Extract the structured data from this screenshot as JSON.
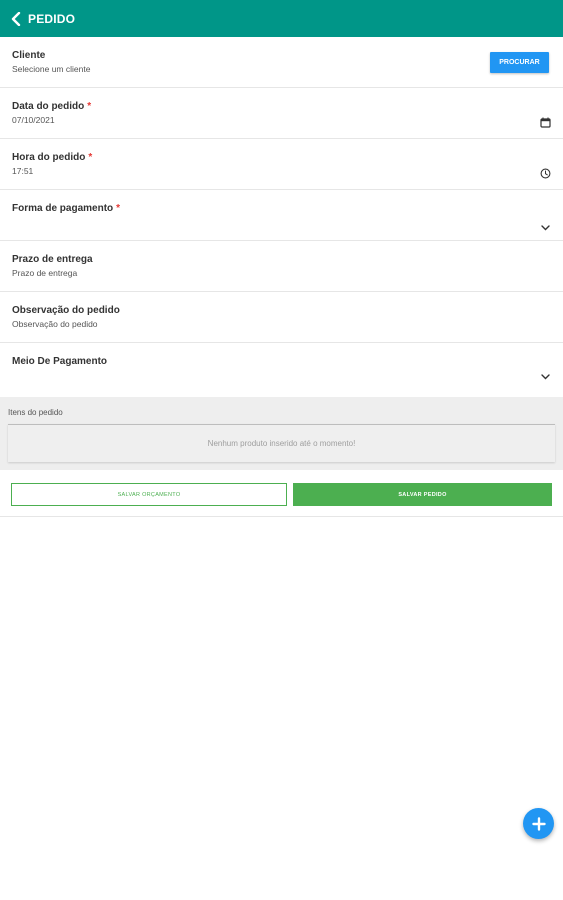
{
  "appbar": {
    "title": "PEDIDO",
    "back_icon": "chevron-left-icon"
  },
  "form": {
    "cliente": {
      "label": "Cliente",
      "value": "Selecione um cliente",
      "button_label": "PROCURAR"
    },
    "data_pedido": {
      "label": "Data do pedido",
      "required": "*",
      "value": "07/10/2021",
      "icon": "calendar-icon"
    },
    "hora_pedido": {
      "label": "Hora do pedido",
      "required": "*",
      "value": "17:51",
      "icon": "clock-icon"
    },
    "forma_pagamento": {
      "label": "Forma de pagamento",
      "required": "*",
      "value": "",
      "icon": "chevron-down-icon"
    },
    "prazo_entrega": {
      "label": "Prazo de entrega",
      "placeholder": "Prazo de entrega"
    },
    "observacao": {
      "label": "Observação do pedido",
      "placeholder": "Observação do pedido"
    },
    "meio_pagamento": {
      "label": "Meio De Pagamento",
      "value": "",
      "icon": "chevron-down-icon"
    }
  },
  "items": {
    "title": "Itens do pedido",
    "empty_message": "Nenhum produto inserido até o momento!"
  },
  "actions": {
    "save_quote_label": "SALVAR ORÇAMENTO",
    "save_order_label": "SALVAR PEDIDO"
  },
  "fab": {
    "icon": "plus-icon"
  },
  "colors": {
    "primary": "#009688",
    "accent": "#2196f3",
    "success": "#4caf50",
    "required": "#e53935"
  }
}
